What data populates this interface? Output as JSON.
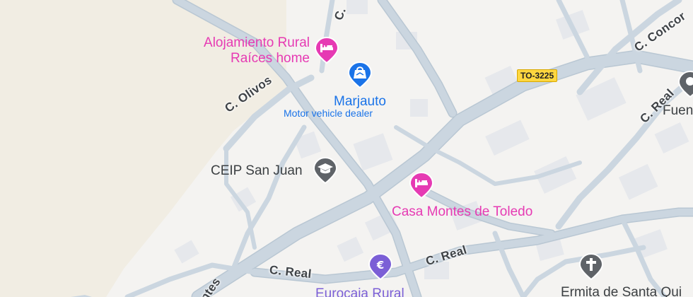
{
  "map": {
    "colors": {
      "land": "#f4f3f1",
      "open_area": "#f1ede3",
      "road": "#cbd6e0",
      "road_edge": "#b9c7d3",
      "building": "#e6e8ec",
      "lodging": "#e63ab3",
      "shopping": "#1a73e8",
      "school": "#5f6368",
      "finance": "#7b5fd6",
      "church": "#5f6368"
    },
    "pois": {
      "alojamiento": {
        "name_line1": "Alojamiento Rural",
        "name_line2": "Raíces home",
        "icon": "bed-icon",
        "category": "lodging"
      },
      "marjauto": {
        "name": "Marjauto",
        "subtitle": "Motor vehicle dealer",
        "icon": "shopping-bag-icon",
        "category": "shopping"
      },
      "ceip": {
        "name": "CEIP San Juan",
        "icon": "graduation-cap-icon",
        "category": "school"
      },
      "casa_montes": {
        "name": "Casa Montes de Toledo",
        "icon": "bed-icon",
        "category": "lodging"
      },
      "eurocaja": {
        "name": "Eurocaja Rural",
        "icon": "euro-icon",
        "category": "finance"
      },
      "ermita": {
        "name": "Ermita de Santa Qui",
        "icon": "cross-icon",
        "category": "church"
      },
      "fuen": {
        "name": "Fuen",
        "icon": "landmark-icon",
        "category": "landmark"
      }
    },
    "roads": {
      "olivos": "C. Olivos",
      "real_1": "C. Real",
      "real_2": "C. Real",
      "real_3": "C. Real",
      "concord": "C. Concor",
      "top_c": "C.",
      "montes": "ontes",
      "to3225": "TO-3225"
    }
  }
}
